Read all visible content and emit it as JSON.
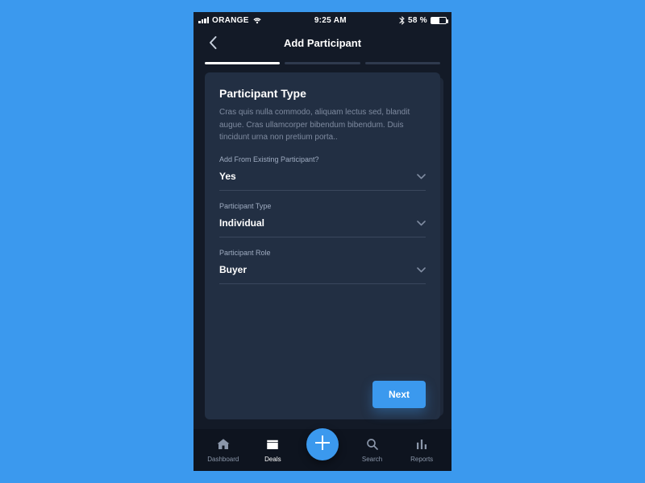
{
  "statusBar": {
    "carrier": "ORANGE",
    "time": "9:25 AM",
    "batteryPercent": "58 %"
  },
  "header": {
    "title": "Add Participant"
  },
  "card": {
    "title": "Participant Type",
    "description": "Cras quis nulla commodo, aliquam lectus sed, blandit augue. Cras ullamcorper bibendum bibendum. Duis tincidunt urna non pretium porta.."
  },
  "fields": {
    "existing": {
      "label": "Add From Existing Participant?",
      "value": "Yes"
    },
    "type": {
      "label": "Participant Type",
      "value": "Individual"
    },
    "role": {
      "label": "Participant Role",
      "value": "Buyer"
    }
  },
  "buttons": {
    "next": "Next"
  },
  "tabs": {
    "dashboard": "Dashboard",
    "deals": "Deals",
    "search": "Search",
    "reports": "Reports"
  },
  "colors": {
    "accent": "#3b99ee",
    "cardBg": "#222f43",
    "pageBg": "#131a27"
  }
}
